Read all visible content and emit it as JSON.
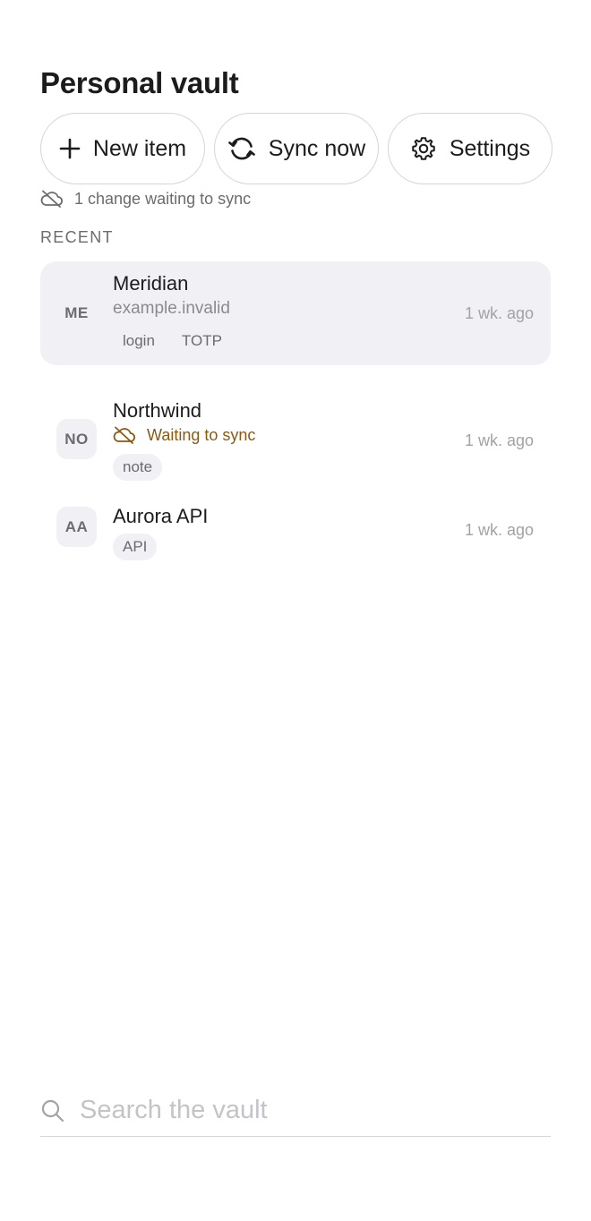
{
  "header": {
    "title": "Personal vault"
  },
  "actions": {
    "new_item": "New item",
    "sync_now": "Sync now",
    "settings": "Settings"
  },
  "sync_status": {
    "text": "1 change waiting to sync"
  },
  "section": {
    "label": "RECENT"
  },
  "items": [
    {
      "initials": "ME",
      "name": "Meridian",
      "subtitle": "example.invalid",
      "tags": [
        "login",
        "TOTP"
      ],
      "time": "1 wk. ago",
      "selected": true
    },
    {
      "initials": "NO",
      "name": "Northwind",
      "status": "Waiting to sync",
      "tags": [
        "note"
      ],
      "time": "1 wk. ago"
    },
    {
      "initials": "AA",
      "name": "Aurora API",
      "tags": [
        "API"
      ],
      "time": "1 wk. ago"
    }
  ],
  "search": {
    "placeholder": "Search the vault",
    "value": ""
  },
  "colors": {
    "accent_warning": "#8a5a12",
    "selected_bg": "#f1f1f5",
    "muted_text": "#6b6b70"
  },
  "icons": [
    "plus-icon",
    "sync-icon",
    "gear-icon",
    "cloud-off-icon",
    "search-icon"
  ]
}
